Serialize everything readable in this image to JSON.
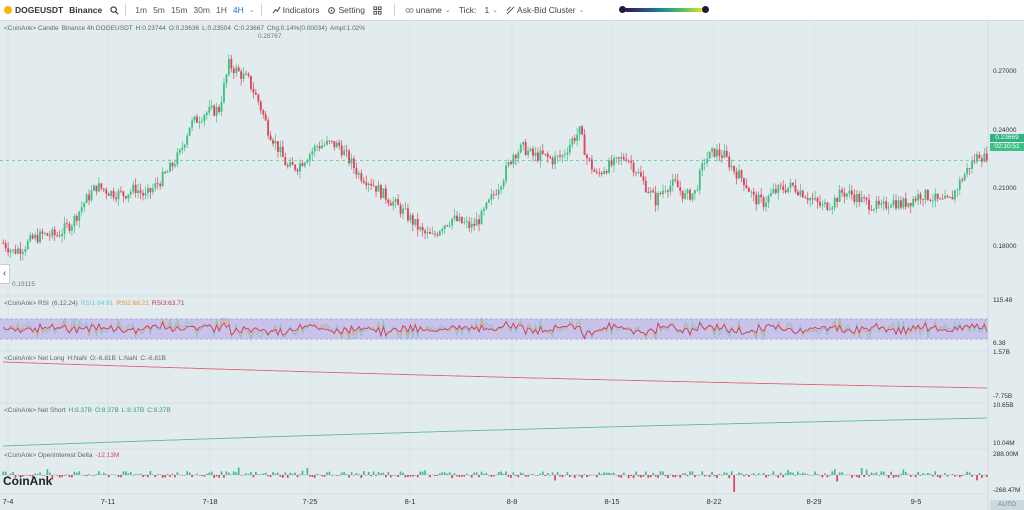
{
  "toolbar": {
    "symbol": "DOGEUSDT",
    "exchange": "Binance",
    "timeframes": [
      "1m",
      "5m",
      "15m",
      "30m",
      "1H",
      "4H"
    ],
    "active_timeframe": "4H",
    "indicators_label": "Indicators",
    "setting_label": "Setting",
    "uname_label": "uname",
    "tick_label": "Tick:",
    "tick_value": "1",
    "cluster_label": "Ask-Bid Cluster",
    "colorscale": [
      "#2b1650",
      "#2c4a8c",
      "#20908c",
      "#5cc15c",
      "#e6e32a"
    ]
  },
  "panels": {
    "candle": {
      "prefix": "<CoinAnk> Candle",
      "desc": "Binance 4h DOGEUSDT",
      "h": "H:0.23744",
      "o": "O:0.23636",
      "l": "L:0.23504",
      "c": "C:0.23667",
      "chg": "Chg:0.14%(0.00034)",
      "ampl": "Ampl:1.02%",
      "high_mark": "0.28767",
      "low_mark": "0.19115"
    },
    "rsi": {
      "prefix": "<CoinAnk> RSI",
      "params": "(6,12,24)",
      "rsi1": "RSI1:64.91",
      "rsi2": "RSI2:68.21",
      "rsi3": "RSI3:63.71"
    },
    "netlong": {
      "prefix": "<CoinAnk> Net Long",
      "h": "H:NaN",
      "o": "O:-6.81B",
      "l": "L:NaN",
      "c": "C:-6.81B"
    },
    "netshort": {
      "prefix": "<CoinAnk> Net Short",
      "h": "H:8.37B",
      "o": "O:8.37B",
      "l": "L:8.37B",
      "c": "C:8.37B"
    },
    "oi": {
      "prefix": "<CoinAnk> OpenInterest Delta",
      "value": "-12.13M"
    }
  },
  "y_labels": {
    "price": [
      "0.27000",
      "0.24000",
      "0.21000",
      "0.18000"
    ],
    "rsi": [
      "115.48",
      "6.38"
    ],
    "netlong": [
      "1.57B",
      "-7.75B"
    ],
    "netshort": [
      "10.65B",
      "10.04M"
    ],
    "oi": [
      "288.00M",
      "-268.47M"
    ]
  },
  "price_box": {
    "price": "0.23669",
    "countdown": "02:10:51"
  },
  "x_labels": [
    "7-4",
    "7-11",
    "7-18",
    "7-25",
    "8-1",
    "8-8",
    "8-15",
    "8-22",
    "8-29",
    "9-5"
  ],
  "logo": "CoinAnk",
  "auto_label": "AUTO",
  "colors": {
    "up": "#3fbf84",
    "down": "#e0435a",
    "rsi1": "#6fc9d8",
    "rsi2": "#f0a04a",
    "rsi3": "#c0336a",
    "rsi_band": "#b9a8ea",
    "netlong": "#e06474",
    "netshort": "#5fbf8a",
    "background": "#e2ecee"
  },
  "chart_data": {
    "type": "candlestick",
    "x_ticks": [
      "7-4",
      "7-11",
      "7-18",
      "7-25",
      "8-1",
      "8-8",
      "8-15",
      "8-22",
      "8-29",
      "9-5"
    ],
    "price_range": [
      0.17,
      0.3
    ],
    "price_path": [
      [
        0,
        0.196
      ],
      [
        4,
        0.192
      ],
      [
        8,
        0.194
      ],
      [
        12,
        0.198
      ],
      [
        16,
        0.2
      ],
      [
        22,
        0.2
      ],
      [
        28,
        0.206
      ],
      [
        33,
        0.216
      ],
      [
        38,
        0.224
      ],
      [
        44,
        0.221
      ],
      [
        49,
        0.22
      ],
      [
        54,
        0.223
      ],
      [
        58,
        0.219
      ],
      [
        62,
        0.224
      ],
      [
        67,
        0.231
      ],
      [
        72,
        0.24
      ],
      [
        76,
        0.254
      ],
      [
        82,
        0.26
      ],
      [
        88,
        0.262
      ],
      [
        92,
        0.284
      ],
      [
        96,
        0.28
      ],
      [
        100,
        0.276
      ],
      [
        104,
        0.266
      ],
      [
        108,
        0.252
      ],
      [
        112,
        0.243
      ],
      [
        116,
        0.233
      ],
      [
        120,
        0.234
      ],
      [
        124,
        0.239
      ],
      [
        128,
        0.244
      ],
      [
        133,
        0.245
      ],
      [
        137,
        0.244
      ],
      [
        141,
        0.237
      ],
      [
        145,
        0.23
      ],
      [
        150,
        0.226
      ],
      [
        155,
        0.22
      ],
      [
        160,
        0.215
      ],
      [
        166,
        0.208
      ],
      [
        171,
        0.201
      ],
      [
        175,
        0.199
      ],
      [
        179,
        0.205
      ],
      [
        183,
        0.208
      ],
      [
        187,
        0.206
      ],
      [
        191,
        0.204
      ],
      [
        195,
        0.209
      ],
      [
        199,
        0.218
      ],
      [
        204,
        0.229
      ],
      [
        208,
        0.24
      ],
      [
        212,
        0.243
      ],
      [
        216,
        0.239
      ],
      [
        220,
        0.239
      ],
      [
        224,
        0.237
      ],
      [
        228,
        0.239
      ],
      [
        232,
        0.247
      ],
      [
        235,
        0.251
      ],
      [
        238,
        0.238
      ],
      [
        242,
        0.229
      ],
      [
        245,
        0.233
      ],
      [
        249,
        0.235
      ],
      [
        254,
        0.239
      ],
      [
        258,
        0.232
      ],
      [
        262,
        0.224
      ],
      [
        266,
        0.217
      ],
      [
        270,
        0.224
      ],
      [
        274,
        0.225
      ],
      [
        278,
        0.219
      ],
      [
        282,
        0.221
      ],
      [
        286,
        0.237
      ],
      [
        290,
        0.241
      ],
      [
        294,
        0.239
      ],
      [
        298,
        0.232
      ],
      [
        302,
        0.227
      ],
      [
        306,
        0.218
      ],
      [
        310,
        0.216
      ],
      [
        314,
        0.221
      ],
      [
        318,
        0.223
      ],
      [
        322,
        0.224
      ],
      [
        326,
        0.221
      ],
      [
        330,
        0.217
      ],
      [
        334,
        0.214
      ],
      [
        338,
        0.216
      ],
      [
        342,
        0.221
      ],
      [
        346,
        0.22
      ],
      [
        350,
        0.217
      ],
      [
        354,
        0.215
      ],
      [
        358,
        0.213
      ],
      [
        362,
        0.217
      ],
      [
        366,
        0.215
      ],
      [
        370,
        0.217
      ],
      [
        374,
        0.22
      ],
      [
        378,
        0.219
      ],
      [
        382,
        0.216
      ],
      [
        386,
        0.217
      ],
      [
        390,
        0.226
      ],
      [
        394,
        0.234
      ],
      [
        398,
        0.24
      ],
      [
        401,
        0.237
      ]
    ],
    "last_price": 0.23669,
    "period_high": 0.28767,
    "period_low": 0.19115,
    "oi_range": [
      -268.47,
      288.0
    ],
    "netlong_range": [
      -7.75,
      1.57
    ],
    "netshort_range": [
      0.01004,
      10.65
    ]
  }
}
